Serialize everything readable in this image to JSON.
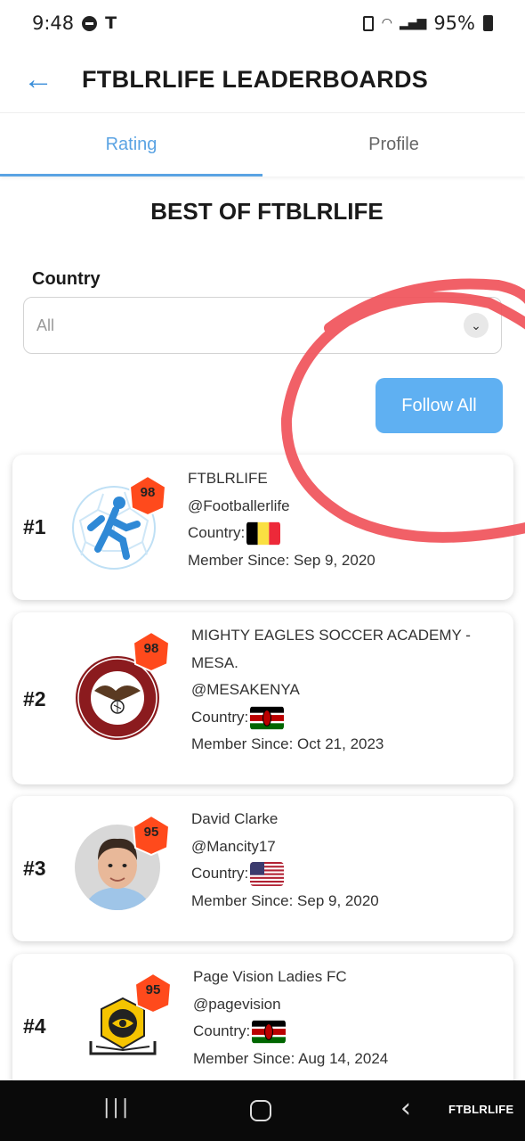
{
  "status": {
    "time": "9:48",
    "battery": "95%"
  },
  "header": {
    "title": "FTBLRLIFE LEADERBOARDS"
  },
  "tabs": [
    {
      "label": "Rating"
    },
    {
      "label": "Profile"
    }
  ],
  "section_title": "BEST OF FTBLRLIFE",
  "filter": {
    "label": "Country",
    "value": "All"
  },
  "follow_all": "Follow All",
  "entries": [
    {
      "rank": "#1",
      "rating": "98",
      "name_lines": [
        "FTBLRLIFE"
      ],
      "handle": "@Footballerlife",
      "country_label": "Country:",
      "country": "Belgium",
      "member_since": "Member Since: Sep 9, 2020"
    },
    {
      "rank": "#2",
      "rating": "98",
      "name_lines": [
        "MIGHTY EAGLES SOCCER ACADEMY -",
        "MESA."
      ],
      "handle": "@MESAKENYA",
      "country_label": "Country:",
      "country": "Kenya",
      "member_since": "Member Since: Oct 21, 2023",
      "logo_text": "MIGHTY EAGLES SOCCER ACADEMY"
    },
    {
      "rank": "#3",
      "rating": "95",
      "name_lines": [
        "David Clarke"
      ],
      "handle": "@Mancity17",
      "country_label": "Country:",
      "country": "United States",
      "member_since": "Member Since: Sep 9, 2020"
    },
    {
      "rank": "#4",
      "rating": "95",
      "name_lines": [
        "Page Vision Ladies FC"
      ],
      "handle": "@pagevision",
      "country_label": "Country:",
      "country": "Kenya",
      "member_since": "Member Since: Aug 14, 2024"
    }
  ],
  "watermark": "FTBLRLIFE",
  "colors": {
    "accent": "#5aa3e3",
    "button": "#5fb0f2",
    "badge": "#ff4a1c",
    "annotation": "#f0525a"
  }
}
